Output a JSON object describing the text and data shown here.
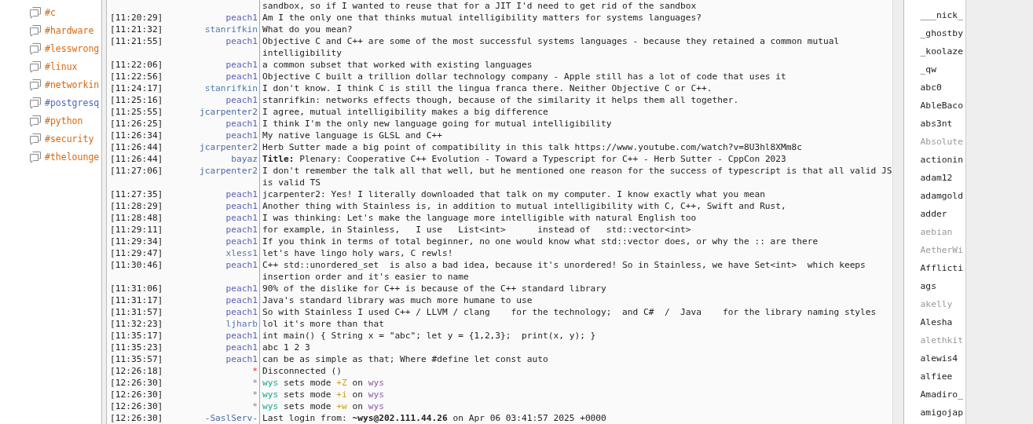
{
  "channels": [
    {
      "name": "#c",
      "color": "#d9680f"
    },
    {
      "name": "#hardware",
      "color": "#d9680f"
    },
    {
      "name": "#lesswrong",
      "color": "#d9680f"
    },
    {
      "name": "#linux",
      "color": "#d9680f"
    },
    {
      "name": "#networkin",
      "color": "#d9680f"
    },
    {
      "name": "#postgresq",
      "color": "#4a6bb8"
    },
    {
      "name": "#python",
      "color": "#d9680f"
    },
    {
      "name": "#security",
      "color": "#d9680f"
    },
    {
      "name": "#thelounge",
      "color": "#d9680f"
    }
  ],
  "messages": [
    {
      "kind": "continuation",
      "lines": [
        "sandbox, so if I wanted to reuse that for a JIT I'd need to get rid of the sandbox"
      ]
    },
    {
      "kind": "text",
      "time": "[11:20:29]",
      "nick": "peach1",
      "color": "#5b63b5",
      "lines": [
        "Am I the only one that thinks mutual intelligibility matters for systems languages?"
      ]
    },
    {
      "kind": "text",
      "time": "[11:21:32]",
      "nick": "stanrifkin",
      "color": "#4d7ab0",
      "lines": [
        "What do you mean?"
      ]
    },
    {
      "kind": "text",
      "time": "[11:21:55]",
      "nick": "peach1",
      "color": "#5b63b5",
      "lines": [
        "Objective C and C++ are some of the most successful systems languages - because they retained a common mutual",
        "intelligibility"
      ]
    },
    {
      "kind": "text",
      "time": "[11:22:06]",
      "nick": "peach1",
      "color": "#5b63b5",
      "lines": [
        "a common subset that worked with existing languages"
      ]
    },
    {
      "kind": "text",
      "time": "[11:22:56]",
      "nick": "peach1",
      "color": "#5b63b5",
      "lines": [
        "Objective C built a trillion dollar technology company - Apple still has a lot of code that uses it"
      ]
    },
    {
      "kind": "text",
      "time": "[11:24:17]",
      "nick": "stanrifkin",
      "color": "#4d7ab0",
      "lines": [
        "I don't know. I think C is still the lingua franca there. Neither Objective C or C++."
      ]
    },
    {
      "kind": "text",
      "time": "[11:25:16]",
      "nick": "peach1",
      "color": "#5b63b5",
      "lines": [
        "stanrifkin: networks effects though, because of the similarity it helps them all together."
      ]
    },
    {
      "kind": "text",
      "time": "[11:25:55]",
      "nick": "jcarpenter2",
      "color": "#4a6aa8",
      "lines": [
        "I agree, mutual intelligibility makes a big difference"
      ]
    },
    {
      "kind": "text",
      "time": "[11:26:25]",
      "nick": "peach1",
      "color": "#5b63b5",
      "lines": [
        "I think I'm the only new language going for mutual intelligibility"
      ]
    },
    {
      "kind": "text",
      "time": "[11:26:34]",
      "nick": "peach1",
      "color": "#5b63b5",
      "lines": [
        "My native language is GLSL and C++"
      ]
    },
    {
      "kind": "text",
      "time": "[11:26:44]",
      "nick": "jcarpenter2",
      "color": "#4a6aa8",
      "lines": [
        "Herb Sutter made a big point of compatibility in this talk https://www.youtube.com/watch?v=8U3hl8XMm8c"
      ]
    },
    {
      "kind": "text",
      "time": "[11:26:44]",
      "nick": "bayaz",
      "color": "#4a6aa8",
      "lines": [
        "**Title:** Plenary: Cooperative C++ Evolution - Toward a Typescript for C++ - Herb Sutter - CppCon 2023"
      ]
    },
    {
      "kind": "text",
      "time": "[11:27:06]",
      "nick": "jcarpenter2",
      "color": "#4a6aa8",
      "lines": [
        "I don't remember the talk all that well, but he mentioned one reason for the success of typescript is that all valid JS",
        "is valid TS"
      ]
    },
    {
      "kind": "text",
      "time": "[11:27:35]",
      "nick": "peach1",
      "color": "#5b63b5",
      "lines": [
        "jcarpenter2: Yes! I literally downloaded that talk on my computer. I know exactly what you mean"
      ]
    },
    {
      "kind": "text",
      "time": "[11:28:29]",
      "nick": "peach1",
      "color": "#5b63b5",
      "lines": [
        "Another thing with Stainless is, in addition to mutual intelligibility with C, C++, Swift and Rust,"
      ]
    },
    {
      "kind": "text",
      "time": "[11:28:48]",
      "nick": "peach1",
      "color": "#5b63b5",
      "lines": [
        "I was thinking: Let's make the language more intelligible with natural English too"
      ]
    },
    {
      "kind": "text",
      "time": "[11:29:11]",
      "nick": "peach1",
      "color": "#5b63b5",
      "lines": [
        "for example, in Stainless,   I use   List<int>      instead of   std::vector<int>"
      ]
    },
    {
      "kind": "text",
      "time": "[11:29:34]",
      "nick": "peach1",
      "color": "#5b63b5",
      "lines": [
        "If you think in terms of total beginner, no one would know what std::vector does, or why the :: are there"
      ]
    },
    {
      "kind": "text",
      "time": "[11:29:47]",
      "nick": "xless1",
      "color": "#4d7ab0",
      "lines": [
        "let's have lingo holy wars, C rewls!"
      ]
    },
    {
      "kind": "text",
      "time": "[11:30:46]",
      "nick": "peach1",
      "color": "#5b63b5",
      "lines": [
        "C++ std::unordered_set  is also a bad idea, because it's unordered! So in Stainless, we have Set<int>  which keeps",
        "insertion order and it's easier to name"
      ]
    },
    {
      "kind": "text",
      "time": "[11:31:06]",
      "nick": "peach1",
      "color": "#5b63b5",
      "lines": [
        "90% of the dislike for C++ is because of the C++ standard library"
      ]
    },
    {
      "kind": "text",
      "time": "[11:31:17]",
      "nick": "peach1",
      "color": "#5b63b5",
      "lines": [
        "Java's standard library was much more humane to use"
      ]
    },
    {
      "kind": "text",
      "time": "[11:31:57]",
      "nick": "peach1",
      "color": "#5b63b5",
      "lines": [
        "So with Stainless I used C++ / LLVM / clang    for the technology;  and C#  /  Java    for the library naming styles"
      ]
    },
    {
      "kind": "text",
      "time": "[11:32:23]",
      "nick": "ljharb",
      "color": "#4d7ab0",
      "lines": [
        "lol it's more than that"
      ]
    },
    {
      "kind": "text",
      "time": "[11:35:17]",
      "nick": "peach1",
      "color": "#5b63b5",
      "lines": [
        "int main() { String x = \"abc\"; let y = {1,2,3};  print(x, y); }"
      ]
    },
    {
      "kind": "text",
      "time": "[11:35:23]",
      "nick": "peach1",
      "color": "#5b63b5",
      "lines": [
        "abc 1 2 3"
      ]
    },
    {
      "kind": "text",
      "time": "[11:35:57]",
      "nick": "peach1",
      "color": "#5b63b5",
      "lines": [
        "can be as simple as that; Where #define let const auto"
      ]
    },
    {
      "kind": "error",
      "time": "[12:26:18]",
      "nick": "*",
      "lines": [
        "Disconnected ()"
      ]
    },
    {
      "kind": "mode",
      "time": "[12:26:30]",
      "nick": "*",
      "parts": [
        {
          "text": "wys",
          "color": "#1aa58a"
        },
        {
          "text": " sets mode "
        },
        {
          "text": "+Z",
          "color": "#c9a21a"
        },
        {
          "text": " on "
        },
        {
          "text": "wys",
          "color": "#8a5aa8"
        }
      ]
    },
    {
      "kind": "mode",
      "time": "[12:26:30]",
      "nick": "*",
      "parts": [
        {
          "text": "wys",
          "color": "#1aa58a"
        },
        {
          "text": " sets mode "
        },
        {
          "text": "+i",
          "color": "#c9a21a"
        },
        {
          "text": " on "
        },
        {
          "text": "wys",
          "color": "#8a5aa8"
        }
      ]
    },
    {
      "kind": "mode",
      "time": "[12:26:30]",
      "nick": "*",
      "parts": [
        {
          "text": "wys",
          "color": "#1aa58a"
        },
        {
          "text": " sets mode "
        },
        {
          "text": "+w",
          "color": "#c9a21a"
        },
        {
          "text": " on "
        },
        {
          "text": "wys",
          "color": "#8a5aa8"
        }
      ]
    },
    {
      "kind": "text",
      "time": "[12:26:30]",
      "nick": "-SaslServ-",
      "color": "#4a6aa8",
      "lines": [
        "Last login from: **~wys@202.111.44.26** on Apr 06 03:41:57 2025 +0000"
      ]
    }
  ],
  "users": [
    {
      "name": "___nick_",
      "away": false
    },
    {
      "name": "_ghostby",
      "away": false
    },
    {
      "name": "_koolaze",
      "away": false
    },
    {
      "name": "_qw",
      "away": false
    },
    {
      "name": "abc0",
      "away": false
    },
    {
      "name": "AbleBaco",
      "away": false
    },
    {
      "name": "abs3nt",
      "away": false
    },
    {
      "name": "Absolute",
      "away": true
    },
    {
      "name": "actionin",
      "away": false
    },
    {
      "name": "adam12",
      "away": false
    },
    {
      "name": "adamgold",
      "away": false
    },
    {
      "name": "adder",
      "away": false
    },
    {
      "name": "aebian",
      "away": true
    },
    {
      "name": "AetherWi",
      "away": true
    },
    {
      "name": "Afflicti",
      "away": false
    },
    {
      "name": "ags",
      "away": false
    },
    {
      "name": "akelly",
      "away": true
    },
    {
      "name": "Alesha",
      "away": false
    },
    {
      "name": "alethkit",
      "away": true
    },
    {
      "name": "alewis4",
      "away": false
    },
    {
      "name": "alfiee",
      "away": false
    },
    {
      "name": "Amadiro_",
      "away": false
    },
    {
      "name": "amigojap",
      "away": false
    }
  ]
}
